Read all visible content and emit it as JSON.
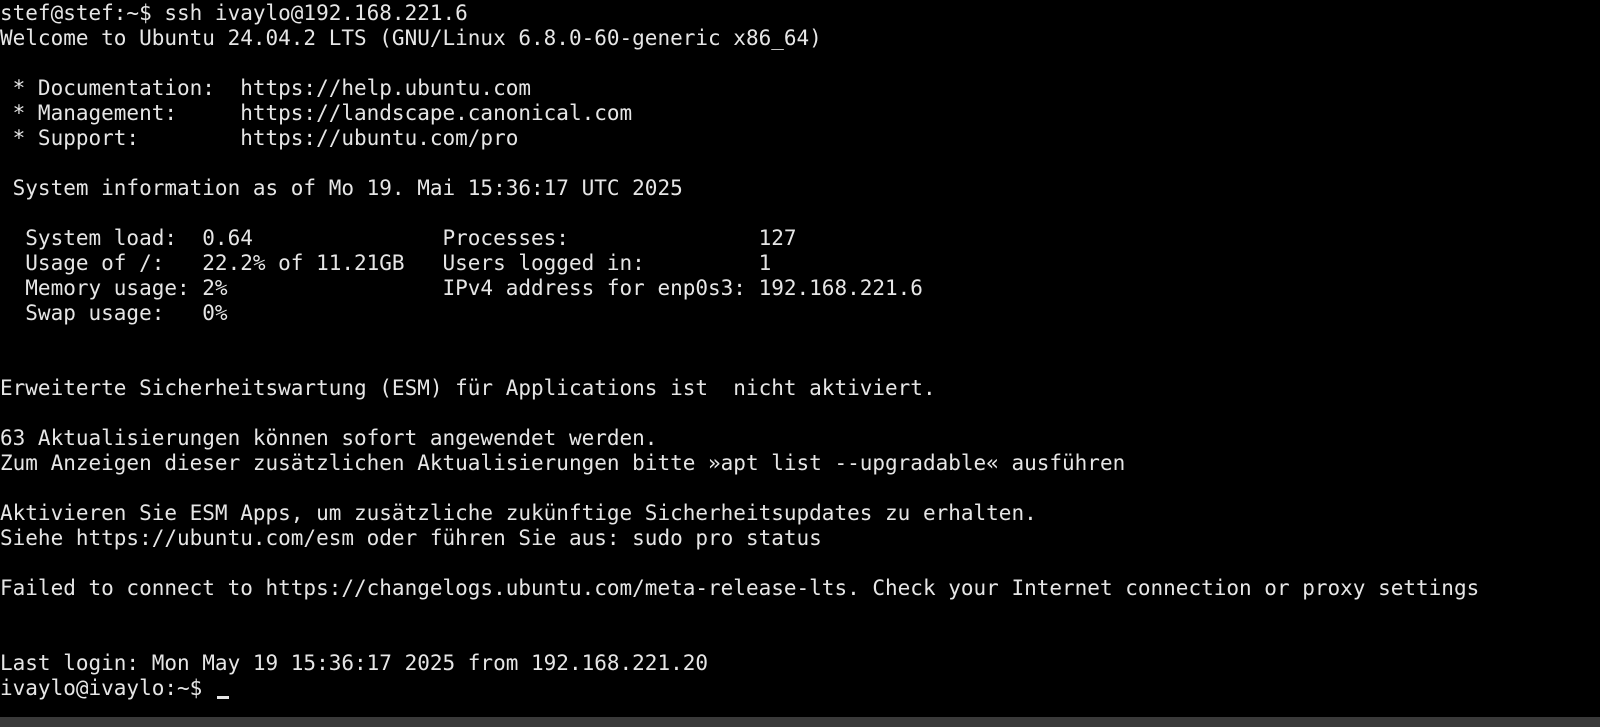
{
  "terminal": {
    "lines": [
      "stef@stef:~$ ssh ivaylo@192.168.221.6",
      "Welcome to Ubuntu 24.04.2 LTS (GNU/Linux 6.8.0-60-generic x86_64)",
      "",
      " * Documentation:  https://help.ubuntu.com",
      " * Management:     https://landscape.canonical.com",
      " * Support:        https://ubuntu.com/pro",
      "",
      " System information as of Mo 19. Mai 15:36:17 UTC 2025",
      "",
      "  System load:  0.64               Processes:               127",
      "  Usage of /:   22.2% of 11.21GB   Users logged in:         1",
      "  Memory usage: 2%                 IPv4 address for enp0s3: 192.168.221.6",
      "  Swap usage:   0%",
      "",
      "",
      "Erweiterte Sicherheitswartung (ESM) für Applications ist  nicht aktiviert.",
      "",
      "63 Aktualisierungen können sofort angewendet werden.",
      "Zum Anzeigen dieser zusätzlichen Aktualisierungen bitte »apt list --upgradable« ausführen",
      "",
      "Aktivieren Sie ESM Apps, um zusätzliche zukünftige Sicherheitsupdates zu erhalten.",
      "Siehe https://ubuntu.com/esm oder führen Sie aus: sudo pro status",
      "",
      "Failed to connect to https://changelogs.ubuntu.com/meta-release-lts. Check your Internet connection or proxy settings",
      "",
      "",
      "Last login: Mon May 19 15:36:17 2025 from 192.168.221.20",
      "ivaylo@ivaylo:~$ "
    ]
  },
  "colors": {
    "background": "#000000",
    "foreground": "#e6e6e6",
    "statusbar": "#3a3a3a"
  }
}
